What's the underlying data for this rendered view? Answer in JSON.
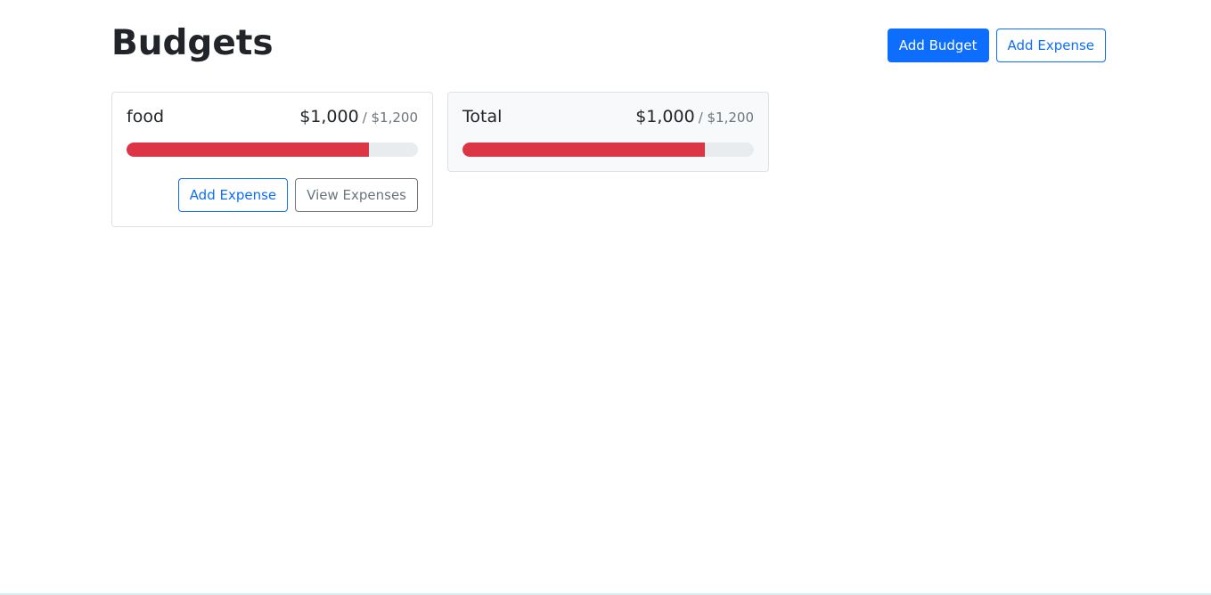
{
  "page": {
    "title": "Budgets"
  },
  "header": {
    "add_budget_label": "Add Budget",
    "add_expense_label": "Add Expense"
  },
  "budgets": [
    {
      "name": "food",
      "amount": "$1,000",
      "max": "/ $1,200",
      "progress_fraction": 0.833,
      "add_expense_label": "Add Expense",
      "view_expenses_label": "View Expenses"
    }
  ],
  "total": {
    "name": "Total",
    "amount": "$1,000",
    "max": "/ $1,200",
    "progress_fraction": 0.833
  },
  "colors": {
    "primary": "#0d6efd",
    "danger": "#dc3545",
    "progress_track": "#e9ecef",
    "secondary": "#6c757d"
  }
}
